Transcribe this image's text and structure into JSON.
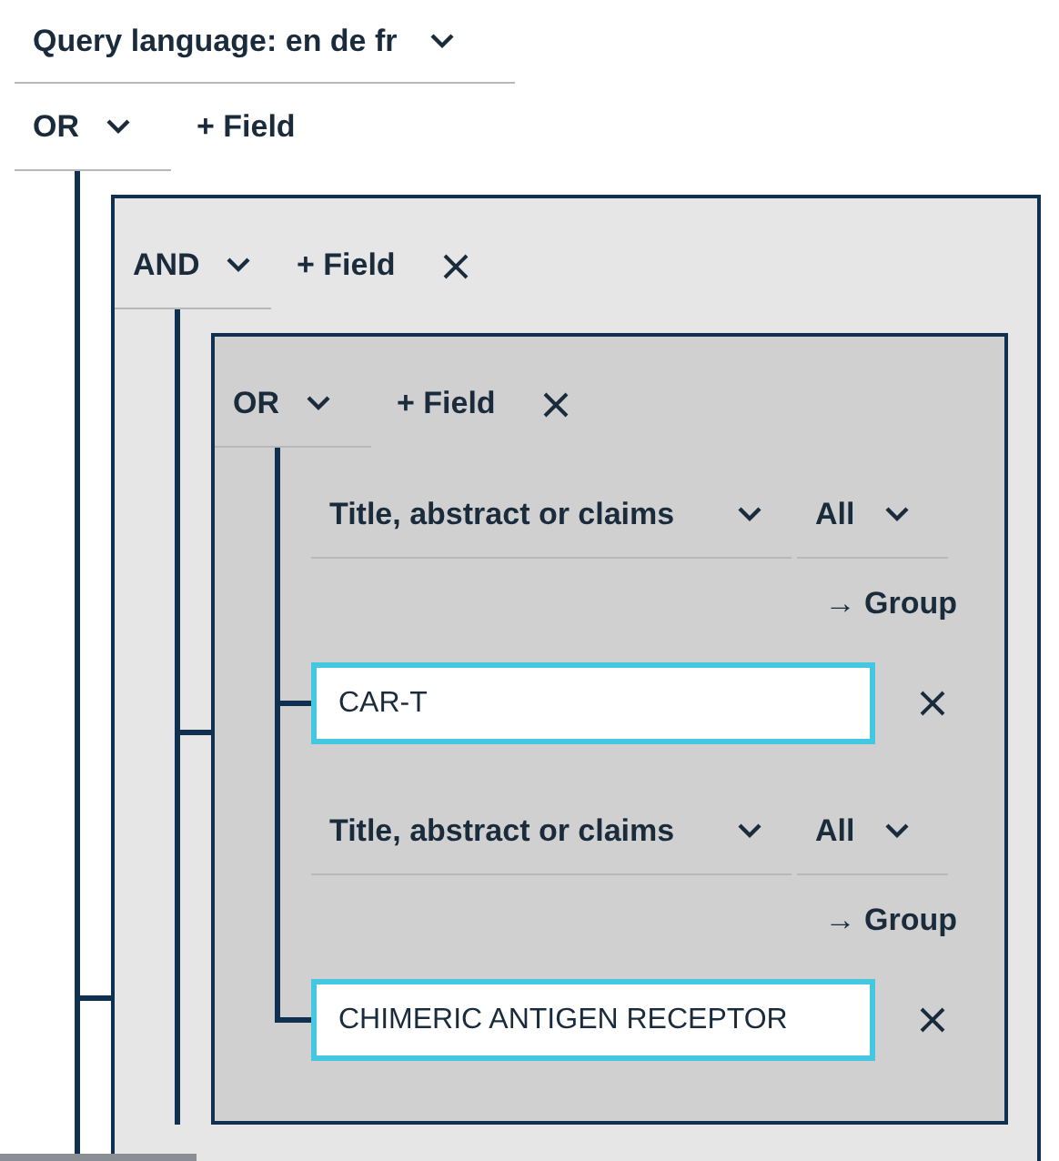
{
  "query_language": {
    "label": "Query language: en de fr"
  },
  "query": {
    "kind": "group",
    "operator": "OR",
    "add_field": "+ Field",
    "removable": false,
    "continued_below": true,
    "children": [
      {
        "kind": "group",
        "operator": "AND",
        "add_field": "+ Field",
        "removable": true,
        "continued_below": true,
        "children": [
          {
            "kind": "group",
            "operator": "OR",
            "add_field": "+ Field",
            "removable": true,
            "continued_below": false,
            "children": [
              {
                "kind": "field",
                "field": "Title, abstract or claims",
                "match": "All",
                "group_link": "→ Group",
                "value": "CAR-T",
                "removable": true
              },
              {
                "kind": "field",
                "field": "Title, abstract or claims",
                "match": "All",
                "group_link": "→ Group",
                "value": "CHIMERIC ANTIGEN RECEPTOR",
                "removable": true
              }
            ]
          }
        ]
      }
    ]
  }
}
